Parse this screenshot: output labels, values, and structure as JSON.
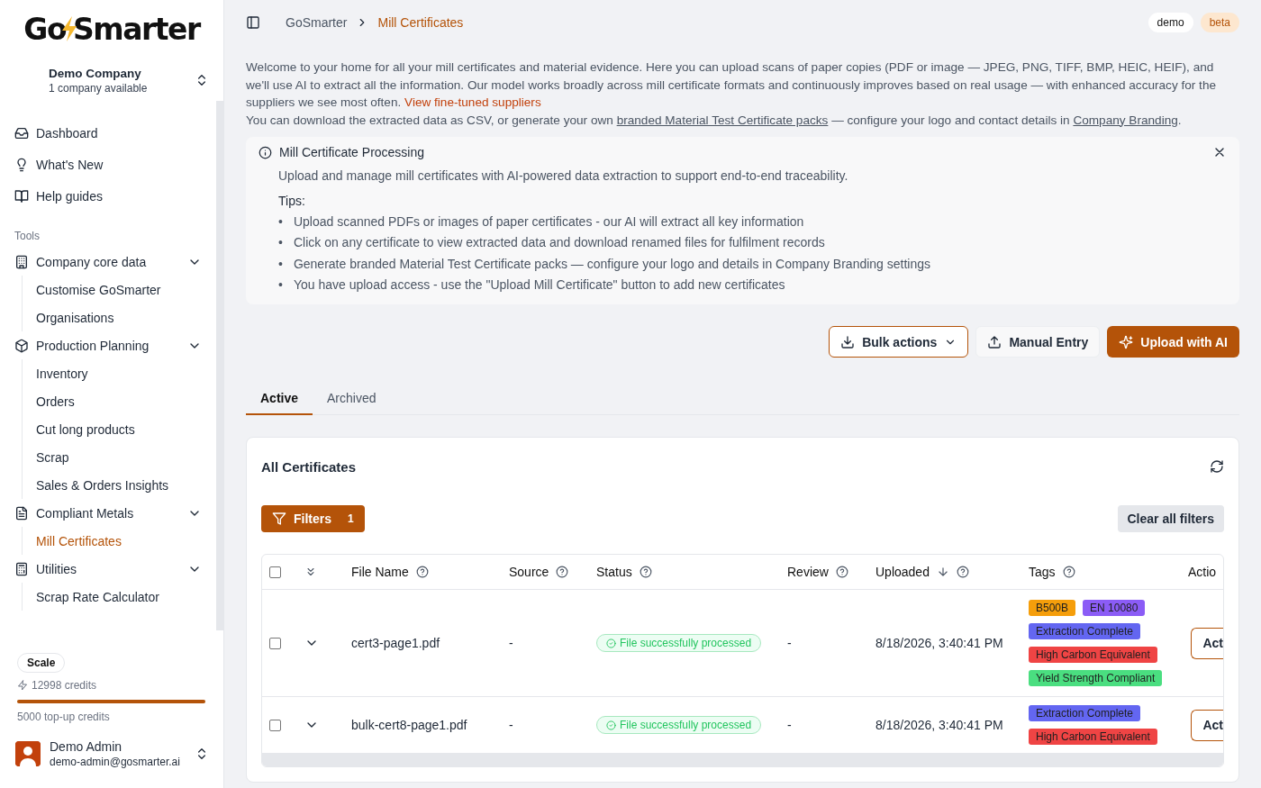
{
  "sidebar": {
    "logo": [
      "Go",
      "Smarter"
    ],
    "company": {
      "name": "Demo Company",
      "subtitle": "1 company available"
    },
    "nav": [
      {
        "label": "Dashboard"
      },
      {
        "label": "What's New"
      },
      {
        "label": "Help guides"
      }
    ],
    "section_label": "Tools",
    "groups": [
      {
        "label": "Company core data",
        "expanded": true,
        "children": [
          {
            "label": "Customise GoSmarter",
            "selected": false
          },
          {
            "label": "Organisations",
            "selected": false
          }
        ]
      },
      {
        "label": "Production Planning",
        "expanded": true,
        "children": [
          {
            "label": "Inventory",
            "selected": false
          },
          {
            "label": "Orders",
            "selected": false
          },
          {
            "label": "Cut long products",
            "selected": false
          },
          {
            "label": "Scrap",
            "selected": false
          },
          {
            "label": "Sales & Orders Insights",
            "selected": false
          }
        ]
      },
      {
        "label": "Compliant Metals",
        "expanded": true,
        "children": [
          {
            "label": "Mill Certificates",
            "selected": true
          }
        ]
      },
      {
        "label": "Utilities",
        "expanded": true,
        "children": [
          {
            "label": "Scrap Rate Calculator",
            "selected": false
          }
        ]
      }
    ],
    "plan": {
      "name": "Scale",
      "credits": "12998 credits",
      "level": 1,
      "topup": "5000 top-up credits"
    },
    "user": {
      "name": "Demo Admin",
      "email": "demo-admin@gosmarter.ai"
    }
  },
  "header": {
    "breadcrumb": [
      "GoSmarter",
      "Mill Certificates"
    ],
    "badges": [
      {
        "label": "demo",
        "kind": "neutral"
      },
      {
        "label": "beta",
        "kind": "accent"
      }
    ]
  },
  "intro": {
    "paragraphs": [
      {
        "parts": [
          {
            "kind": "text",
            "text": "Welcome to your home for all your mill certificates and material evidence. Here you can upload scans of paper copies (PDF or image — JPEG, PNG, TIFF, BMP, HEIC, HEIF), and we'll use AI to extract all the information. Our model works broadly across mill certificate formats and continuously improves based on real usage — with enhanced accuracy for the suppliers we see most often. "
          },
          {
            "kind": "link",
            "text": "View fine-tuned suppliers"
          }
        ]
      },
      {
        "parts": [
          {
            "kind": "text",
            "text": "You can download the extracted data as CSV, or generate your own "
          },
          {
            "kind": "underline",
            "text": "branded Material Test Certificate packs"
          },
          {
            "kind": "text",
            "text": " — configure your logo and contact details in "
          },
          {
            "kind": "underline",
            "text": "Company Branding"
          },
          {
            "kind": "text",
            "text": "."
          }
        ]
      }
    ]
  },
  "notice": {
    "bullet": "•",
    "title": "Mill Certificate Processing",
    "description": "Upload and manage mill certificates with AI-powered data extraction to support end-to-end traceability.",
    "tips_label": "Tips:",
    "tips": [
      "Upload scanned PDFs or images of paper certificates - our AI will extract all key information",
      "Click on any certificate to view extracted data and download renamed files for fulfilment records",
      "Generate branded Material Test Certificate packs — configure your logo and details in Company Branding settings",
      "You have upload access - use the \"Upload Mill Certificate\" button to add new certificates"
    ]
  },
  "actions": [
    {
      "label": "Bulk actions",
      "kind": "outline"
    },
    {
      "label": "Manual Entry",
      "kind": "plain"
    },
    {
      "label": "Upload with AI",
      "kind": "primary"
    }
  ],
  "tabs": [
    {
      "label": "Active",
      "selected": true
    },
    {
      "label": "Archived",
      "selected": false
    }
  ],
  "certificates": {
    "title": "All Certificates",
    "filters": {
      "label": "Filters",
      "count": "1"
    },
    "clear_label": "Clear all filters",
    "select_all": {
      "checked": false
    },
    "columns": [
      {
        "label": "File Name",
        "help": true,
        "sorted": false
      },
      {
        "label": "Source",
        "help": true,
        "sorted": false
      },
      {
        "label": "Status",
        "help": true,
        "sorted": false
      },
      {
        "label": "Review",
        "help": true,
        "sorted": false
      },
      {
        "label": "Uploaded",
        "help": true,
        "sorted": true
      },
      {
        "label": "Tags",
        "help": true,
        "sorted": false
      },
      {
        "label": "Actio",
        "help": false,
        "sorted": false
      }
    ],
    "rows": [
      {
        "checked": false,
        "expanded": false,
        "file_name": "cert3-page1.pdf",
        "source": "-",
        "status": "File successfully processed",
        "review": "-",
        "uploaded": "8/18/2026, 3:40:41 PM",
        "tags": [
          {
            "label": "B500B",
            "color": "#f59e0b"
          },
          {
            "label": "EN 10080",
            "color": "#8b5cf6"
          },
          {
            "label": "Extraction Complete",
            "color": "#6366f1"
          },
          {
            "label": "High Carbon Equivalent",
            "color": "#ef4444"
          },
          {
            "label": "Yield Strength Compliant",
            "color": "#4ade80"
          }
        ],
        "action": "Act"
      },
      {
        "checked": false,
        "expanded": false,
        "file_name": "bulk-cert8-page1.pdf",
        "source": "-",
        "status": "File successfully processed",
        "review": "-",
        "uploaded": "8/18/2026, 3:40:41 PM",
        "tags": [
          {
            "label": "Extraction Complete",
            "color": "#6366f1"
          },
          {
            "label": "High Carbon Equivalent",
            "color": "#ef4444"
          }
        ],
        "action": "Act"
      }
    ]
  }
}
